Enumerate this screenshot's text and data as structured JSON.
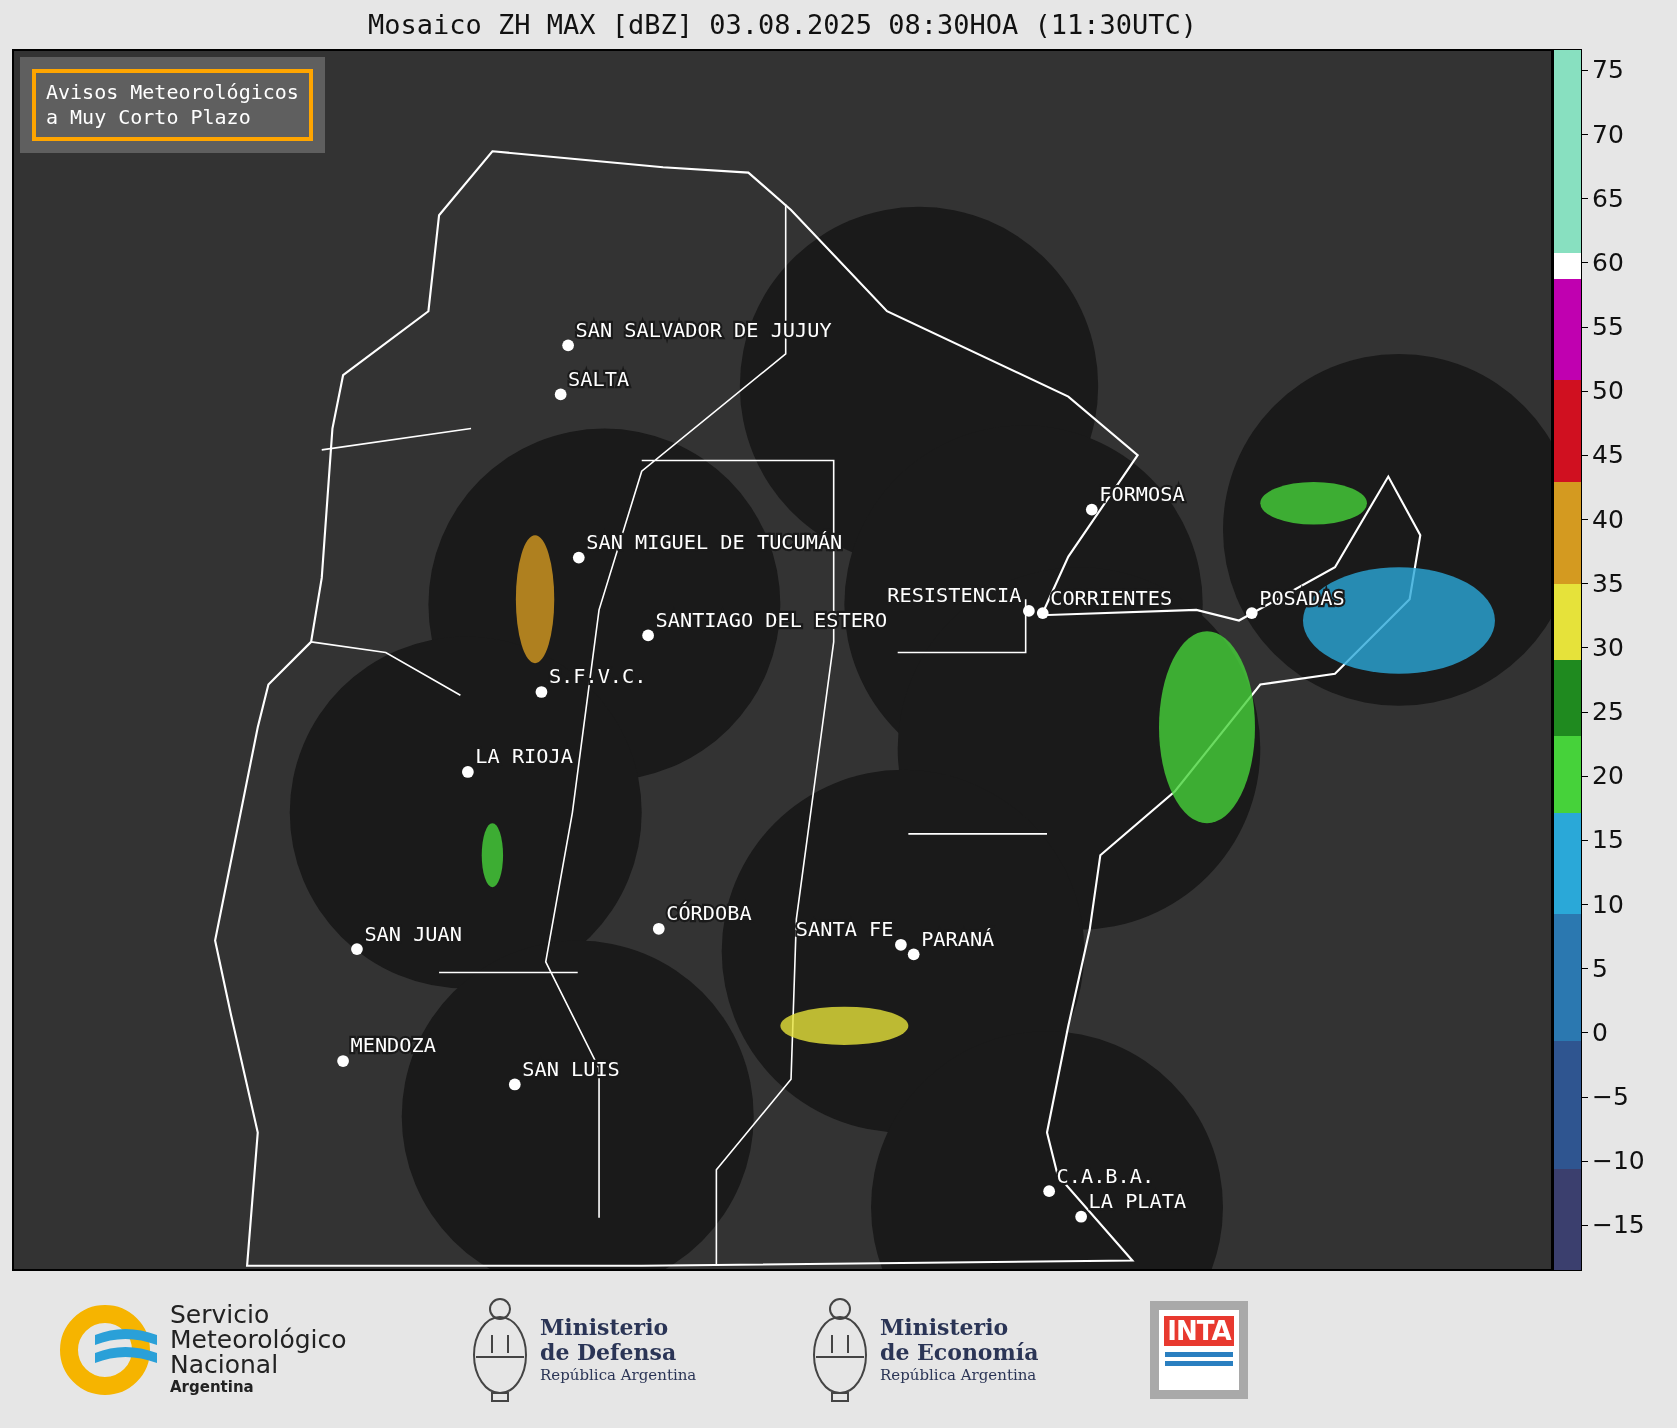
{
  "title": "Mosaico ZH MAX [dBZ] 03.08.2025 08:30HOA (11:30UTC)",
  "notice": [
    "Avisos Meteorológicos",
    "a Muy Corto Plazo"
  ],
  "cities": [
    {
      "name": "SAN SALVADOR DE JUJUY"
    },
    {
      "name": "SALTA"
    },
    {
      "name": "FORMOSA"
    },
    {
      "name": "SAN MIGUEL DE TUCUMÁN"
    },
    {
      "name": "RESISTENCIA"
    },
    {
      "name": "CORRIENTES"
    },
    {
      "name": "POSADAS"
    },
    {
      "name": "SANTIAGO DEL ESTERO"
    },
    {
      "name": "S.F.V.C."
    },
    {
      "name": "LA RIOJA"
    },
    {
      "name": "CÓRDOBA"
    },
    {
      "name": "SAN JUAN"
    },
    {
      "name": "SANTA FE"
    },
    {
      "name": "PARANÁ"
    },
    {
      "name": "MENDOZA"
    },
    {
      "name": "SAN LUIS"
    },
    {
      "name": "C.A.B.A."
    },
    {
      "name": "LA PLATA"
    }
  ],
  "colorbar_ticks": [
    "75",
    "70",
    "65",
    "60",
    "55",
    "50",
    "45",
    "40",
    "35",
    "30",
    "25",
    "20",
    "15",
    "10",
    "5",
    "0",
    "−5",
    "−10",
    "−15"
  ],
  "logos": [
    {
      "kind": "smn",
      "lines": [
        "Servicio",
        "Meteorológico",
        "Nacional"
      ],
      "sub": "Argentina"
    },
    {
      "kind": "ministry",
      "lines": [
        "Ministerio",
        "de Defensa"
      ],
      "sub": "República Argentina"
    },
    {
      "kind": "ministry",
      "lines": [
        "Ministerio",
        "de Economía"
      ],
      "sub": "República Argentina"
    },
    {
      "kind": "inta",
      "lines": [
        "INTA"
      ]
    }
  ]
}
